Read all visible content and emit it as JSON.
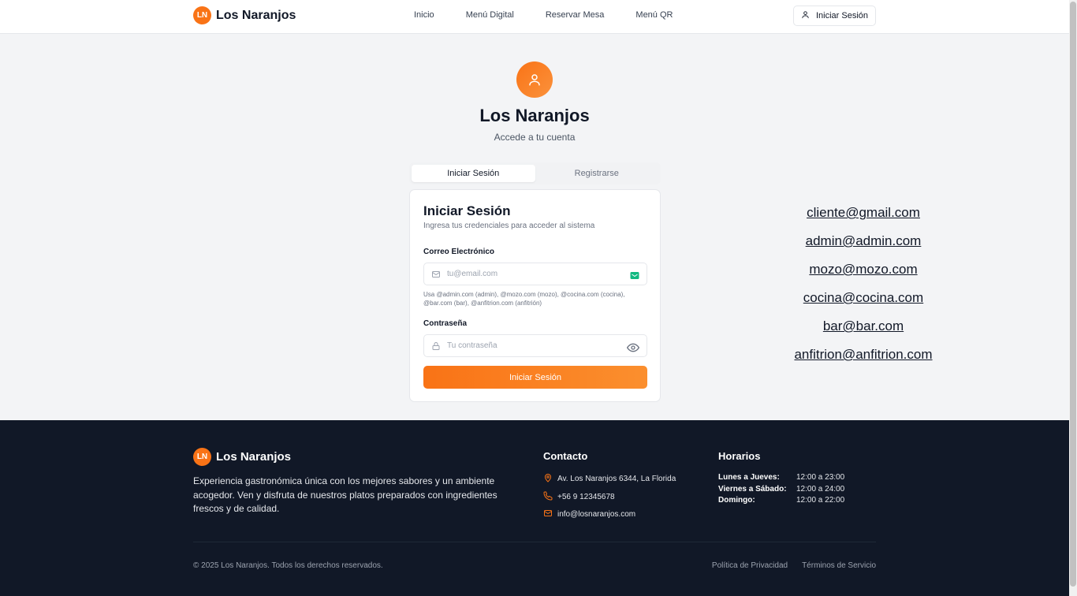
{
  "brand": {
    "initials": "LN",
    "name": "Los Naranjos",
    "accent": "#f97316"
  },
  "nav": {
    "items": [
      "Inicio",
      "Menú Digital",
      "Reservar Mesa",
      "Menú QR"
    ],
    "login_label": "Iniciar Sesión"
  },
  "hero": {
    "title": "Los Naranjos",
    "subtitle": "Accede a tu cuenta"
  },
  "tabs": {
    "login": "Iniciar Sesión",
    "register": "Registrarse"
  },
  "form": {
    "title": "Iniciar Sesión",
    "description": "Ingresa tus credenciales para acceder al sistema",
    "email_label": "Correo Electrónico",
    "email_placeholder": "tu@email.com",
    "hint": "Usa @admin.com (admin), @mozo.com (mozo), @cocina.com (cocina), @bar.com (bar), @anfitrion.com (anfitrión)",
    "password_label": "Contraseña",
    "password_placeholder": "Tu contraseña",
    "submit_label": "Iniciar Sesión"
  },
  "emails": [
    "cliente@gmail.com",
    "admin@admin.com",
    "mozo@mozo.com",
    "cocina@cocina.com",
    "bar@bar.com",
    "anfitrion@anfitrion.com"
  ],
  "footer": {
    "brand_name": "Los Naranjos",
    "description": "Experiencia gastronómica única con los mejores sabores y un ambiente acogedor. Ven y disfruta de nuestros platos preparados con ingredientes frescos y de calidad.",
    "contact_title": "Contacto",
    "address": "Av. Los Naranjos 6344, La Florida",
    "phone": "+56 9 12345678",
    "email": "info@losnaranjos.com",
    "hours_title": "Horarios",
    "hours": [
      {
        "day": "Lunes a Jueves:",
        "time": "12:00 a 23:00"
      },
      {
        "day": "Viernes a Sábado:",
        "time": "12:00 a 24:00"
      },
      {
        "day": "Domingo:",
        "time": "12:00 a 22:00"
      }
    ],
    "copyright": "© 2025 Los Naranjos. Todos los derechos reservados.",
    "privacy": "Política de Privacidad",
    "terms": "Términos de Servicio"
  }
}
